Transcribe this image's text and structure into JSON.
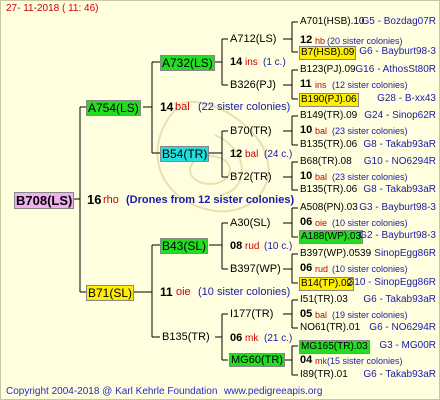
{
  "header": "27- 11-2018 ( 11: 46)",
  "footer": {
    "copyright": "Copyright 2004-2018 @ Karl Kehrle Foundation",
    "site": "www.pedigreeapis.org"
  },
  "root": {
    "id": "B708(LS)",
    "gen": "16",
    "type": "rho",
    "note": "(Drones from 12 sister colonies)"
  },
  "level1": [
    {
      "id": "A754(LS)",
      "gen": "14",
      "type": "bal",
      "note": "(22 sister colonies)"
    },
    {
      "id": "B71(SL)",
      "gen": "11",
      "type": "oie",
      "note": "(10 sister colonies)"
    }
  ],
  "level2": [
    {
      "id": "A732(LS)",
      "gen": "14",
      "type": "ins",
      "note": "(1 c.)"
    },
    {
      "id": "B54(TR)",
      "gen": "12",
      "type": "bal",
      "note": "(24 c.)"
    },
    {
      "id": "B43(SL)",
      "gen": "08",
      "type": "rud",
      "note": "(10 c.)"
    },
    {
      "id": "B135(TR)",
      "gen": "06",
      "type": "mk",
      "note": "(21 c.)"
    }
  ],
  "level3": [
    {
      "id": "A712(LS)"
    },
    {
      "id": "B326(PJ)"
    },
    {
      "id": "B70(TR)"
    },
    {
      "id": "B72(TR)"
    },
    {
      "id": "A30(SL)"
    },
    {
      "id": "B397(WP)"
    },
    {
      "id": "I177(TR)"
    },
    {
      "id": "MG60(TR)"
    }
  ],
  "level4": [
    {
      "id": "A701(HSB).10",
      "loc": "G5 - Bozdag07R"
    },
    {
      "gen": "12",
      "type": "hb",
      "note": "(20 sister colonies)"
    },
    {
      "id": "B7(HSB).09",
      "loc": "G6 - Bayburt98-3"
    },
    {
      "id": "B123(PJ).09",
      "loc": "G16 - AthosSt80R"
    },
    {
      "gen": "11",
      "type": "ins",
      "note": "(12 sister colonies)"
    },
    {
      "id": "B190(PJ).06",
      "loc": "G28 - B-xx43"
    },
    {
      "id": "B149(TR).09",
      "loc": "G24 - Sinop62R"
    },
    {
      "gen": "10",
      "type": "bal",
      "note": "(23 sister colonies)"
    },
    {
      "id": "B135(TR).06",
      "loc": "G8 - Takab93aR"
    },
    {
      "id": "B68(TR).08",
      "loc": "G10 - NO6294R"
    },
    {
      "gen": "10",
      "type": "bal",
      "note": "(23 sister colonies)"
    },
    {
      "id": "B135(TR).06",
      "loc": "G8 - Takab93aR"
    },
    {
      "id": "A508(PN).03",
      "loc": "G3 - Bayburt98-3"
    },
    {
      "gen": "06",
      "type": "oie",
      "note": "(10 sister colonies)"
    },
    {
      "id": "A188(WP).03",
      "loc": "G2 - Bayburt98-3"
    },
    {
      "id": "B397(WP).0539",
      "loc": "- SinopEgg86R"
    },
    {
      "gen": "06",
      "type": "rud",
      "note": "(10 sister colonies)"
    },
    {
      "id": "B14(TP).02",
      "loc": "G10 - SinopEgg86R"
    },
    {
      "id": "I51(TR).03",
      "loc": "G6 - Takab93aR"
    },
    {
      "gen": "05",
      "type": "bal",
      "note": "(19 sister colonies)"
    },
    {
      "id": "NO61(TR).01",
      "loc": "G6 - NO6294R"
    },
    {
      "id": "MG165(TR).03",
      "loc": "G3 - MG00R"
    },
    {
      "gen": "04",
      "type": "mk",
      "note": "(15 sister colonies)"
    },
    {
      "id": "I89(TR).01",
      "loc": "G6 - Takab93aR"
    }
  ]
}
